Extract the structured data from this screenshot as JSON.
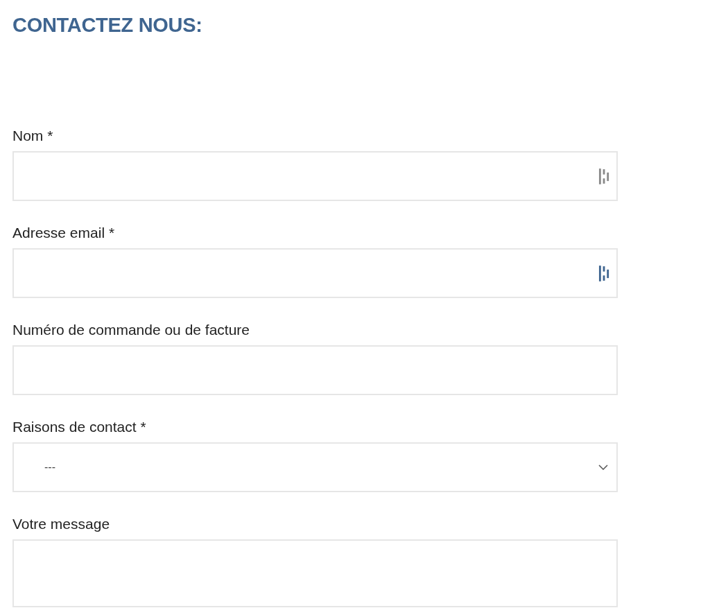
{
  "heading": "CONTACTEZ NOUS:",
  "fields": [
    {
      "kind": "text",
      "label": "Nom *",
      "color": "#8a8a8a"
    },
    {
      "kind": "text",
      "label": "Adresse email *",
      "color": "#3f6590"
    },
    {
      "kind": "text",
      "label": "Numéro de commande ou de facture"
    },
    {
      "kind": "select",
      "label": "Raisons de contact *",
      "value": "---"
    },
    {
      "kind": "textarea",
      "label": "Votre message"
    }
  ]
}
